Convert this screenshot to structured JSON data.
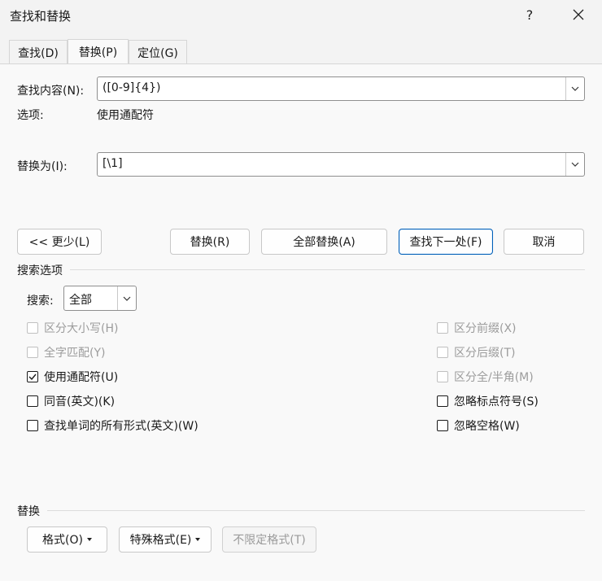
{
  "window": {
    "title": "查找和替换",
    "help": "?",
    "close": "✕"
  },
  "tabs": [
    {
      "label": "查找(D)"
    },
    {
      "label": "替换(P)"
    },
    {
      "label": "定位(G)"
    }
  ],
  "find": {
    "label": "查找内容(N):",
    "value": "([0-9]{4})"
  },
  "options": {
    "label": "选项:",
    "value": "使用通配符"
  },
  "replace": {
    "label": "替换为(I):",
    "value": "[\\1]"
  },
  "buttons": {
    "less": "<< 更少(L)",
    "replace": "替换(R)",
    "replace_all": "全部替换(A)",
    "find_next": "查找下一处(F)",
    "cancel": "取消"
  },
  "search_options": {
    "heading": "搜索选项",
    "search_label": "搜索:",
    "search_value": "全部",
    "left": [
      {
        "label": "区分大小写(H)",
        "checked": false,
        "disabled": true
      },
      {
        "label": "全字匹配(Y)",
        "checked": false,
        "disabled": true
      },
      {
        "label": "使用通配符(U)",
        "checked": true,
        "disabled": false
      },
      {
        "label": "同音(英文)(K)",
        "checked": false,
        "disabled": false
      },
      {
        "label": "查找单词的所有形式(英文)(W)",
        "checked": false,
        "disabled": false
      }
    ],
    "right": [
      {
        "label": "区分前缀(X)",
        "checked": false,
        "disabled": true
      },
      {
        "label": "区分后缀(T)",
        "checked": false,
        "disabled": true
      },
      {
        "label": "区分全/半角(M)",
        "checked": false,
        "disabled": true
      },
      {
        "label": "忽略标点符号(S)",
        "checked": false,
        "disabled": false
      },
      {
        "label": "忽略空格(W)",
        "checked": false,
        "disabled": false
      }
    ]
  },
  "replace_section": {
    "heading": "替换",
    "format": "格式(O)",
    "special": "特殊格式(E)",
    "no_format": "不限定格式(T)"
  }
}
